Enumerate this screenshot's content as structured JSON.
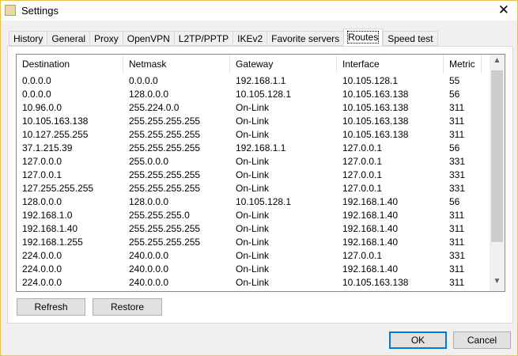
{
  "window": {
    "title": "Settings",
    "close_icon": "close-icon"
  },
  "tabs": [
    "History",
    "General",
    "Proxy",
    "OpenVPN",
    "L2TP/PPTP",
    "IKEv2",
    "Favorite servers",
    "Routes",
    "Speed test"
  ],
  "active_tab": "Routes",
  "table": {
    "columns": [
      "Destination",
      "Netmask",
      "Gateway",
      "Interface",
      "Metric"
    ],
    "rows": [
      [
        "0.0.0.0",
        "0.0.0.0",
        "192.168.1.1",
        "10.105.128.1",
        "55"
      ],
      [
        "0.0.0.0",
        "128.0.0.0",
        "10.105.128.1",
        "10.105.163.138",
        "56"
      ],
      [
        "10.96.0.0",
        "255.224.0.0",
        "On-Link",
        "10.105.163.138",
        "311"
      ],
      [
        "10.105.163.138",
        "255.255.255.255",
        "On-Link",
        "10.105.163.138",
        "311"
      ],
      [
        "10.127.255.255",
        "255.255.255.255",
        "On-Link",
        "10.105.163.138",
        "311"
      ],
      [
        "37.1.215.39",
        "255.255.255.255",
        "192.168.1.1",
        "127.0.0.1",
        "56"
      ],
      [
        "127.0.0.0",
        "255.0.0.0",
        "On-Link",
        "127.0.0.1",
        "331"
      ],
      [
        "127.0.0.1",
        "255.255.255.255",
        "On-Link",
        "127.0.0.1",
        "331"
      ],
      [
        "127.255.255.255",
        "255.255.255.255",
        "On-Link",
        "127.0.0.1",
        "331"
      ],
      [
        "128.0.0.0",
        "128.0.0.0",
        "10.105.128.1",
        "192.168.1.40",
        "56"
      ],
      [
        "192.168.1.0",
        "255.255.255.0",
        "On-Link",
        "192.168.1.40",
        "311"
      ],
      [
        "192.168.1.40",
        "255.255.255.255",
        "On-Link",
        "192.168.1.40",
        "311"
      ],
      [
        "192.168.1.255",
        "255.255.255.255",
        "On-Link",
        "192.168.1.40",
        "311"
      ],
      [
        "224.0.0.0",
        "240.0.0.0",
        "On-Link",
        "127.0.0.1",
        "331"
      ],
      [
        "224.0.0.0",
        "240.0.0.0",
        "On-Link",
        "192.168.1.40",
        "311"
      ],
      [
        "224.0.0.0",
        "240.0.0.0",
        "On-Link",
        "10.105.163.138",
        "311"
      ]
    ]
  },
  "buttons": {
    "refresh": "Refresh",
    "restore": "Restore",
    "ok": "OK",
    "cancel": "Cancel"
  },
  "scrollbar": {
    "up": "^",
    "down": "v"
  }
}
